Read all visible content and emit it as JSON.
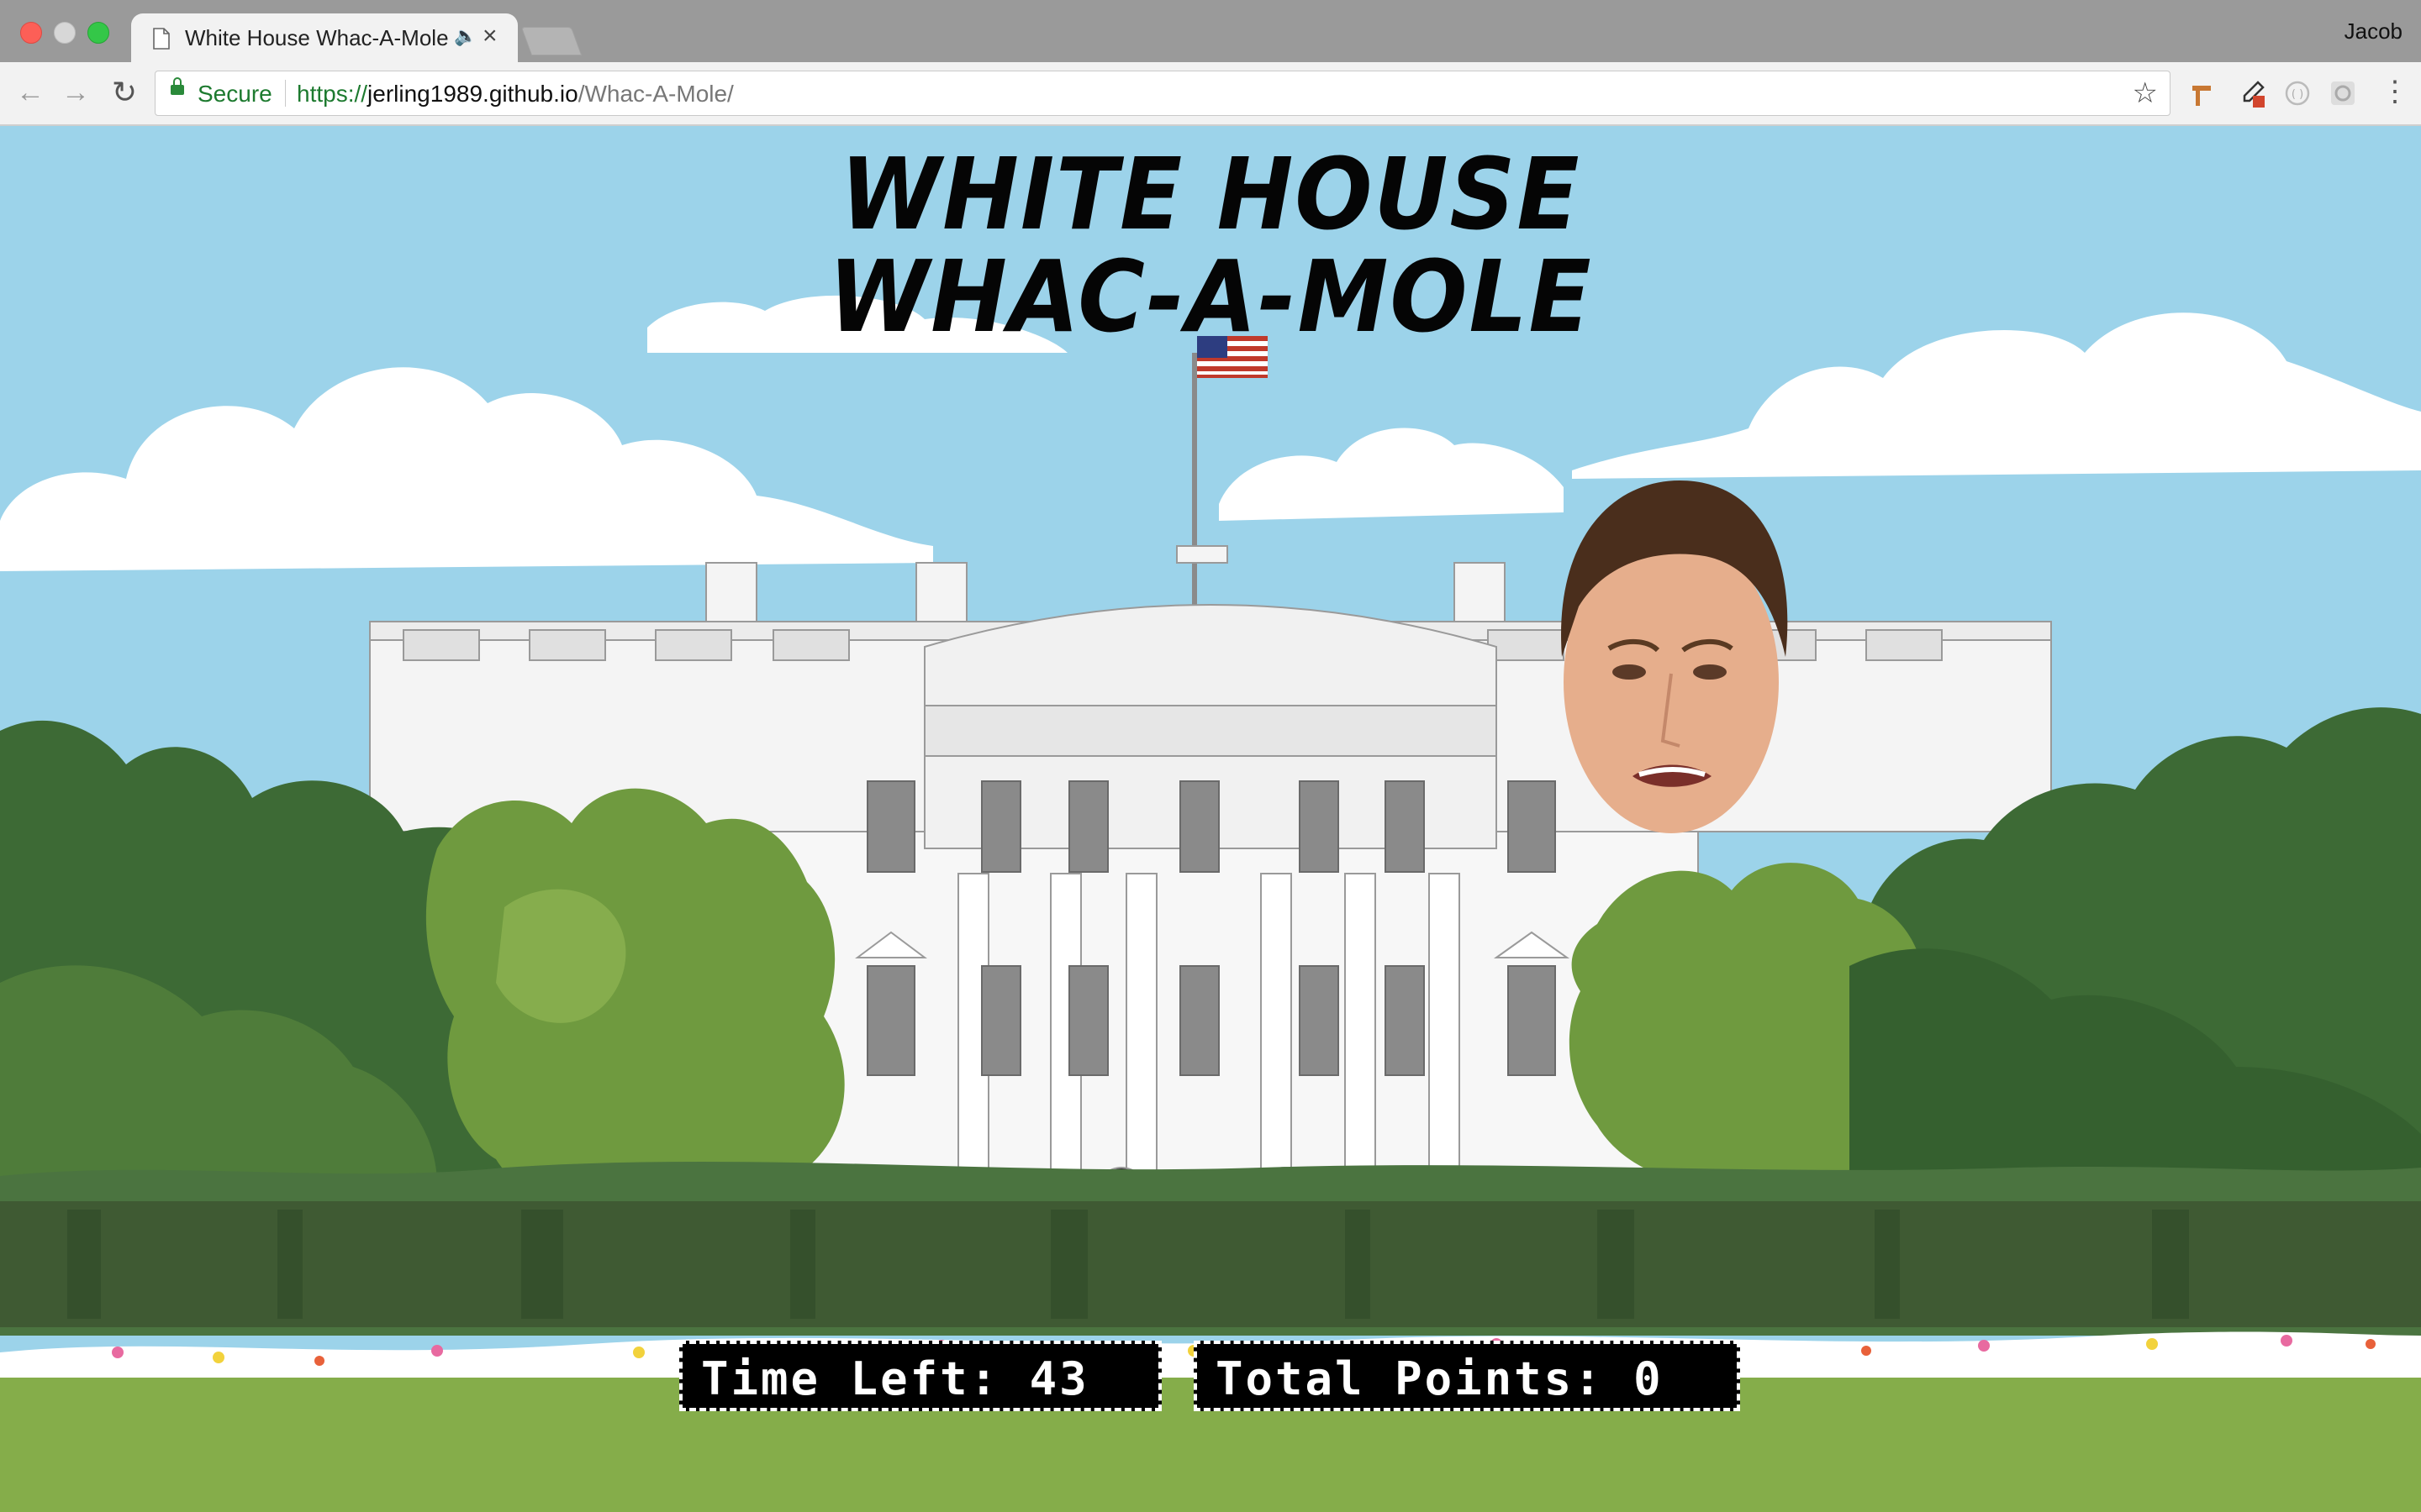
{
  "browser": {
    "tab_title": "White House Whac-A-Mole",
    "profile_name": "Jacob",
    "security_label": "Secure",
    "url_scheme": "https://",
    "url_host": "jerling1989.github.io",
    "url_path": "/Whac-A-Mole/"
  },
  "game": {
    "title_line1": "WHITE HOUSE",
    "title_line2": "WHAC-A-MOLE",
    "time_left_label": "Time Left:",
    "time_left_value": "43",
    "points_label": "Total Points:",
    "points_value": "0"
  },
  "icons": [
    "page-icon",
    "audio-icon",
    "close-icon",
    "back-arrow-icon",
    "forward-arrow-icon",
    "reload-icon",
    "lock-icon",
    "star-icon",
    "menu-icon"
  ],
  "colors": {
    "sky": "#9cd3ea",
    "lawn": "#85ad4a",
    "hedge": "#3f5a33",
    "tree_dark": "#3d6a35",
    "tree_light": "#6f9a3f"
  }
}
